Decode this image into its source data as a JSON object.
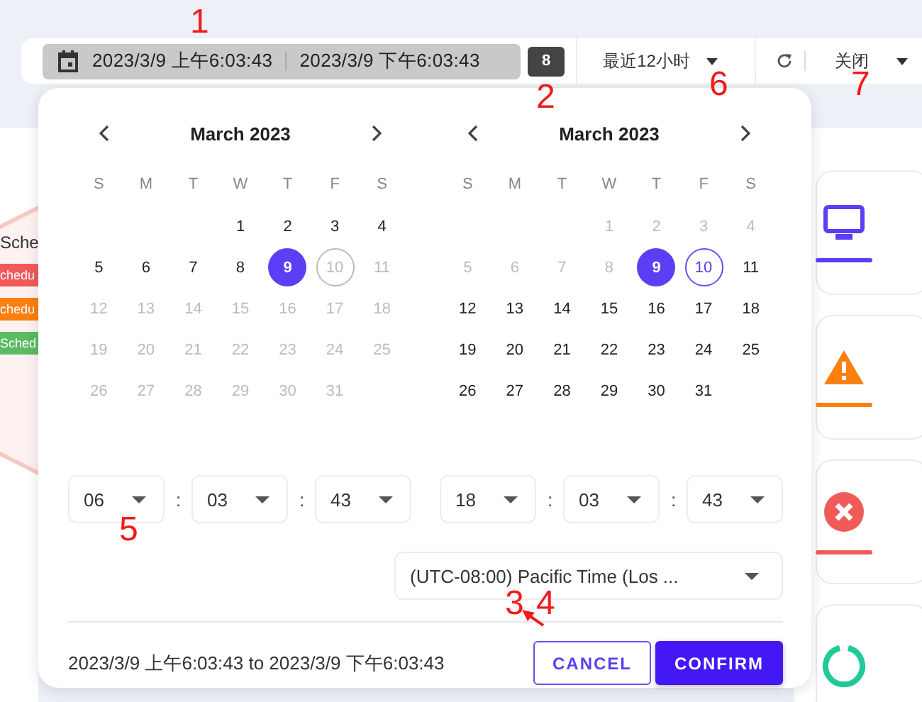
{
  "toolbar": {
    "range_start": "2023/3/9 上午6:03:43",
    "range_end": "2023/3/9 下午6:03:43",
    "badge": "8",
    "preset": "最近12小时",
    "refresh_label": "关闭"
  },
  "background": {
    "title": "Sche",
    "tags": [
      {
        "label": "chedu",
        "color": "#f25a5a"
      },
      {
        "label": "chedu",
        "color": "#fb8010"
      },
      {
        "label": "Sched",
        "color": "#5cba62"
      }
    ],
    "cards": [
      {
        "kind": "monitor"
      },
      {
        "kind": "warning"
      },
      {
        "kind": "error"
      },
      {
        "kind": "ring"
      }
    ]
  },
  "picker": {
    "calendars": [
      {
        "title": "March 2023",
        "weekdays": [
          "S",
          "M",
          "T",
          "W",
          "T",
          "F",
          "S"
        ],
        "weeks": [
          {
            "kind": "leading",
            "days": [
              {
                "label": "1",
                "disabled": false,
                "selected": false,
                "outlined": false
              },
              {
                "label": "2",
                "disabled": false,
                "selected": false,
                "outlined": false
              },
              {
                "label": "3",
                "disabled": false,
                "selected": false,
                "outlined": false
              },
              {
                "label": "4",
                "disabled": false,
                "selected": false,
                "outlined": false
              }
            ]
          },
          {
            "kind": "full",
            "days": [
              {
                "label": "5",
                "disabled": false,
                "selected": false,
                "outlined": false
              },
              {
                "label": "6",
                "disabled": false,
                "selected": false,
                "outlined": false
              },
              {
                "label": "7",
                "disabled": false,
                "selected": false,
                "outlined": false
              },
              {
                "label": "8",
                "disabled": false,
                "selected": false,
                "outlined": false
              },
              {
                "label": "9",
                "disabled": false,
                "selected": true,
                "outlined": false
              },
              {
                "label": "10",
                "disabled": true,
                "selected": false,
                "outlined": true
              },
              {
                "label": "11",
                "disabled": true,
                "selected": false,
                "outlined": false
              }
            ]
          },
          {
            "kind": "full",
            "days": [
              {
                "label": "12",
                "disabled": true,
                "selected": false,
                "outlined": false
              },
              {
                "label": "13",
                "disabled": true,
                "selected": false,
                "outlined": false
              },
              {
                "label": "14",
                "disabled": true,
                "selected": false,
                "outlined": false
              },
              {
                "label": "15",
                "disabled": true,
                "selected": false,
                "outlined": false
              },
              {
                "label": "16",
                "disabled": true,
                "selected": false,
                "outlined": false
              },
              {
                "label": "17",
                "disabled": true,
                "selected": false,
                "outlined": false
              },
              {
                "label": "18",
                "disabled": true,
                "selected": false,
                "outlined": false
              }
            ]
          },
          {
            "kind": "full",
            "days": [
              {
                "label": "19",
                "disabled": true,
                "selected": false,
                "outlined": false
              },
              {
                "label": "20",
                "disabled": true,
                "selected": false,
                "outlined": false
              },
              {
                "label": "21",
                "disabled": true,
                "selected": false,
                "outlined": false
              },
              {
                "label": "22",
                "disabled": true,
                "selected": false,
                "outlined": false
              },
              {
                "label": "23",
                "disabled": true,
                "selected": false,
                "outlined": false
              },
              {
                "label": "24",
                "disabled": true,
                "selected": false,
                "outlined": false
              },
              {
                "label": "25",
                "disabled": true,
                "selected": false,
                "outlined": false
              }
            ]
          },
          {
            "kind": "trailing",
            "days": [
              {
                "label": "26",
                "disabled": true,
                "selected": false,
                "outlined": false
              },
              {
                "label": "27",
                "disabled": true,
                "selected": false,
                "outlined": false
              },
              {
                "label": "28",
                "disabled": true,
                "selected": false,
                "outlined": false
              },
              {
                "label": "29",
                "disabled": true,
                "selected": false,
                "outlined": false
              },
              {
                "label": "30",
                "disabled": true,
                "selected": false,
                "outlined": false
              },
              {
                "label": "31",
                "disabled": true,
                "selected": false,
                "outlined": false
              }
            ]
          }
        ]
      },
      {
        "title": "March 2023",
        "weekdays": [
          "S",
          "M",
          "T",
          "W",
          "T",
          "F",
          "S"
        ],
        "weeks": [
          {
            "kind": "leading",
            "days": [
              {
                "label": "1",
                "disabled": true,
                "selected": false,
                "outlined": false
              },
              {
                "label": "2",
                "disabled": true,
                "selected": false,
                "outlined": false
              },
              {
                "label": "3",
                "disabled": true,
                "selected": false,
                "outlined": false
              },
              {
                "label": "4",
                "disabled": true,
                "selected": false,
                "outlined": false
              }
            ]
          },
          {
            "kind": "full",
            "days": [
              {
                "label": "5",
                "disabled": true,
                "selected": false,
                "outlined": false
              },
              {
                "label": "6",
                "disabled": true,
                "selected": false,
                "outlined": false
              },
              {
                "label": "7",
                "disabled": true,
                "selected": false,
                "outlined": false
              },
              {
                "label": "8",
                "disabled": true,
                "selected": false,
                "outlined": false
              },
              {
                "label": "9",
                "disabled": false,
                "selected": true,
                "outlined": false
              },
              {
                "label": "10",
                "disabled": false,
                "selected": false,
                "outlined": true
              },
              {
                "label": "11",
                "disabled": false,
                "selected": false,
                "outlined": false
              }
            ]
          },
          {
            "kind": "full",
            "days": [
              {
                "label": "12",
                "disabled": false,
                "selected": false,
                "outlined": false
              },
              {
                "label": "13",
                "disabled": false,
                "selected": false,
                "outlined": false
              },
              {
                "label": "14",
                "disabled": false,
                "selected": false,
                "outlined": false
              },
              {
                "label": "15",
                "disabled": false,
                "selected": false,
                "outlined": false
              },
              {
                "label": "16",
                "disabled": false,
                "selected": false,
                "outlined": false
              },
              {
                "label": "17",
                "disabled": false,
                "selected": false,
                "outlined": false
              },
              {
                "label": "18",
                "disabled": false,
                "selected": false,
                "outlined": false
              }
            ]
          },
          {
            "kind": "full",
            "days": [
              {
                "label": "19",
                "disabled": false,
                "selected": false,
                "outlined": false
              },
              {
                "label": "20",
                "disabled": false,
                "selected": false,
                "outlined": false
              },
              {
                "label": "21",
                "disabled": false,
                "selected": false,
                "outlined": false
              },
              {
                "label": "22",
                "disabled": false,
                "selected": false,
                "outlined": false
              },
              {
                "label": "23",
                "disabled": false,
                "selected": false,
                "outlined": false
              },
              {
                "label": "24",
                "disabled": false,
                "selected": false,
                "outlined": false
              },
              {
                "label": "25",
                "disabled": false,
                "selected": false,
                "outlined": false
              }
            ]
          },
          {
            "kind": "trailing",
            "days": [
              {
                "label": "26",
                "disabled": false,
                "selected": false,
                "outlined": false
              },
              {
                "label": "27",
                "disabled": false,
                "selected": false,
                "outlined": false
              },
              {
                "label": "28",
                "disabled": false,
                "selected": false,
                "outlined": false
              },
              {
                "label": "29",
                "disabled": false,
                "selected": false,
                "outlined": false
              },
              {
                "label": "30",
                "disabled": false,
                "selected": false,
                "outlined": false
              },
              {
                "label": "31",
                "disabled": false,
                "selected": false,
                "outlined": false
              }
            ]
          }
        ]
      }
    ],
    "times": [
      [
        "06",
        "03",
        "43"
      ],
      [
        "18",
        "03",
        "43"
      ]
    ],
    "separator": ":",
    "timezone": "(UTC-08:00) Pacific Time (Los ...",
    "summary": "2023/3/9 上午6:03:43 to 2023/3/9 下午6:03:43",
    "cancel": "CANCEL",
    "confirm": "CONFIRM"
  },
  "annotations": [
    "1",
    "2",
    "3",
    "4",
    "5",
    "6",
    "7"
  ]
}
